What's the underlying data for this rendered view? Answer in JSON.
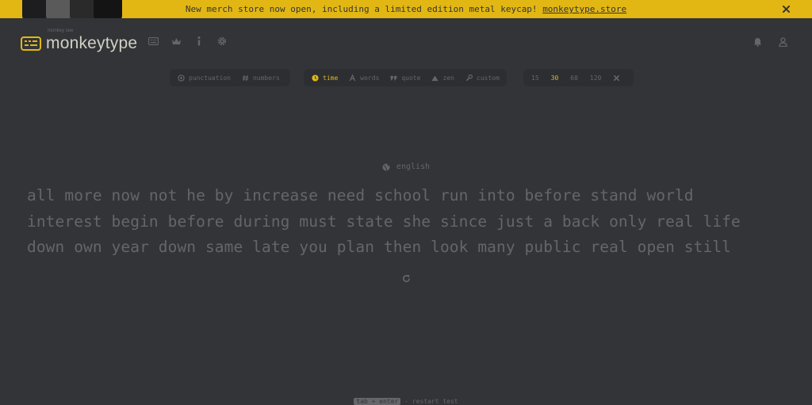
{
  "banner": {
    "text": "New merch store now open, including a limited edition metal keycap! ",
    "link": "monkeytype.store",
    "close": "×"
  },
  "header": {
    "logo_top": "monkey see",
    "logo_text": "monkeytype"
  },
  "config": {
    "punctuation": "punctuation",
    "numbers": "numbers",
    "modes": {
      "time": "time",
      "words": "words",
      "quote": "quote",
      "zen": "zen",
      "custom": "custom"
    },
    "active_mode": "time",
    "durations": [
      "15",
      "30",
      "60",
      "120"
    ],
    "active_duration": "30"
  },
  "test": {
    "language": "english",
    "lines": [
      "all more now not he by increase need school run into before stand world",
      "interest begin before during must state she since just a back only real life",
      "down own year down same late you plan then look many public real open still"
    ]
  },
  "footer": {
    "key": "tab + enter",
    "hint": " - restart test"
  },
  "colors": {
    "accent": "#e2b714",
    "background": "#323437",
    "sub": "#646669",
    "text": "#d1d0c5"
  }
}
